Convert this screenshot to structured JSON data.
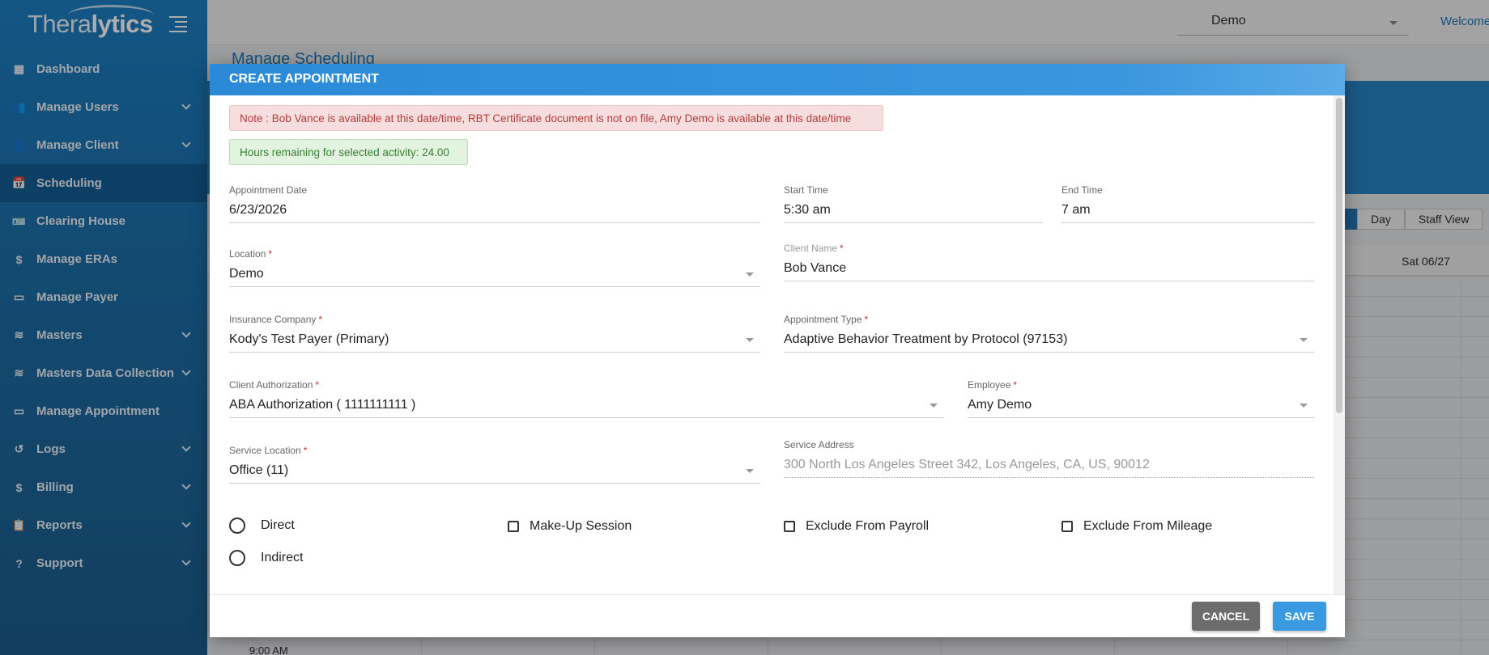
{
  "app": {
    "logo_light": "Thera",
    "logo_bold": "lytics"
  },
  "sidebar": {
    "items": [
      {
        "label": "Dashboard",
        "icon": "dashboard-icon",
        "glyph": "▦",
        "has_chevron": false
      },
      {
        "label": "Manage Users",
        "icon": "users-icon",
        "glyph": "👥",
        "has_chevron": true
      },
      {
        "label": "Manage Client",
        "icon": "person-icon",
        "glyph": "👤",
        "has_chevron": true
      },
      {
        "label": "Scheduling",
        "icon": "calendar-icon",
        "glyph": "📅",
        "has_chevron": false,
        "active": true
      },
      {
        "label": "Clearing House",
        "icon": "id-card-icon",
        "glyph": "🪪",
        "has_chevron": false
      },
      {
        "label": "Manage ERAs",
        "icon": "dollar-icon",
        "glyph": "$",
        "has_chevron": false
      },
      {
        "label": "Manage Payer",
        "icon": "payment-card-icon",
        "glyph": "▭",
        "has_chevron": false
      },
      {
        "label": "Masters",
        "icon": "database-icon",
        "glyph": "≋",
        "has_chevron": true
      },
      {
        "label": "Masters Data Collection",
        "icon": "database-icon",
        "glyph": "≋",
        "has_chevron": true
      },
      {
        "label": "Manage Appointment",
        "icon": "payment-card-icon",
        "glyph": "▭",
        "has_chevron": false
      },
      {
        "label": "Logs",
        "icon": "history-icon",
        "glyph": "↺",
        "has_chevron": true
      },
      {
        "label": "Billing",
        "icon": "dollar-icon",
        "glyph": "$",
        "has_chevron": true
      },
      {
        "label": "Reports",
        "icon": "clipboard-icon",
        "glyph": "📋",
        "has_chevron": true
      },
      {
        "label": "Support",
        "icon": "help-icon",
        "glyph": "?",
        "has_chevron": true
      }
    ]
  },
  "header": {
    "org_selected": "Demo",
    "welcome": "Welcome,"
  },
  "page": {
    "title": "Manage Scheduling",
    "view_buttons": [
      "Day",
      "Staff View"
    ],
    "column_day": "Sat 06/27",
    "time_label": "9:00 AM"
  },
  "modal": {
    "title": "CREATE APPOINTMENT",
    "alert_warning": "Note : Bob Vance is available at this date/time, RBT Certificate document is not on file, Amy Demo is available at this date/time",
    "alert_info": "Hours remaining for selected activity: 24.00",
    "fields": {
      "appointment_date": {
        "label": "Appointment Date",
        "value": "6/23/2026"
      },
      "start_time": {
        "label": "Start Time",
        "value": "5:30 am"
      },
      "end_time": {
        "label": "End Time",
        "value": "7 am"
      },
      "location": {
        "label": "Location",
        "value": "Demo"
      },
      "client_name": {
        "label": "Client Name",
        "value": "Bob Vance"
      },
      "insurance_company": {
        "label": "Insurance Company",
        "value": "Kody's Test Payer (Primary)"
      },
      "appointment_type": {
        "label": "Appointment Type",
        "value": "Adaptive Behavior Treatment by Protocol (97153)"
      },
      "client_authorization": {
        "label": "Client Authorization",
        "value": "ABA Authorization ( 1111111111 )"
      },
      "employee": {
        "label": "Employee",
        "value": "Amy Demo"
      },
      "service_location": {
        "label": "Service Location",
        "value": "Office (11)"
      },
      "service_address": {
        "label": "Service Address",
        "value": "300 North Los Angeles Street 342, Los Angeles, CA, US, 90012"
      }
    },
    "required_mark": "*",
    "options": {
      "direct": "Direct",
      "indirect": "Indirect",
      "makeup": "Make-Up Session",
      "exclude_payroll": "Exclude From Payroll",
      "exclude_mileage": "Exclude From Mileage"
    },
    "buttons": {
      "cancel": "CANCEL",
      "save": "SAVE"
    }
  }
}
